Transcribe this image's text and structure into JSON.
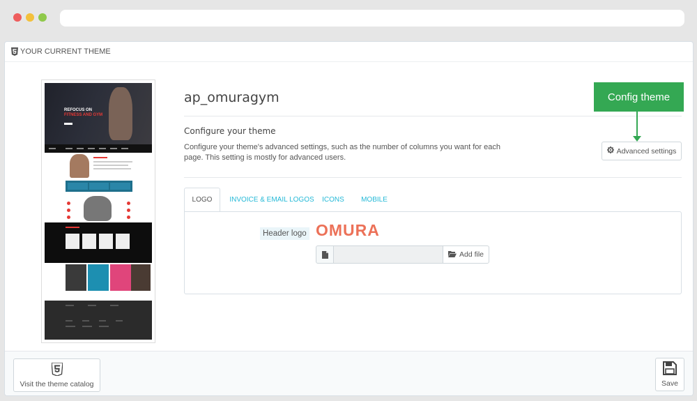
{
  "panel": {
    "heading": "YOUR CURRENT THEME",
    "heading_icon": "html5-icon"
  },
  "theme": {
    "name": "ap_omuragym",
    "preview": {
      "hero_line1": "REFOCUS ON",
      "hero_line2": "FITNESS AND GYM"
    }
  },
  "configure": {
    "title": "Configure your theme",
    "description": "Configure your theme's advanced settings, such as the number of columns you want for each page. This setting is mostly for advanced users.",
    "advanced_button": "Advanced settings",
    "advanced_icon": "gear-icon"
  },
  "callout": {
    "label": "Config theme",
    "color": "#34a853"
  },
  "tabs": [
    {
      "label": "LOGO",
      "active": true
    },
    {
      "label": "INVOICE & EMAIL LOGOS",
      "active": false
    },
    {
      "label": "ICONS",
      "active": false
    },
    {
      "label": "MOBILE",
      "active": false
    }
  ],
  "logo_section": {
    "label": "Header logo",
    "logo_text": "OMURA",
    "logo_color": "#ec7158",
    "file_value": "",
    "add_file_button": "Add file",
    "add_file_icon": "folder-open-icon",
    "file_icon": "file-icon"
  },
  "footer": {
    "catalog_button": "Visit the theme catalog",
    "catalog_icon": "html5-icon",
    "save_button": "Save",
    "save_icon": "floppy-disk-icon"
  },
  "colors": {
    "tab_link": "#25b9d7",
    "text": "#555555"
  }
}
